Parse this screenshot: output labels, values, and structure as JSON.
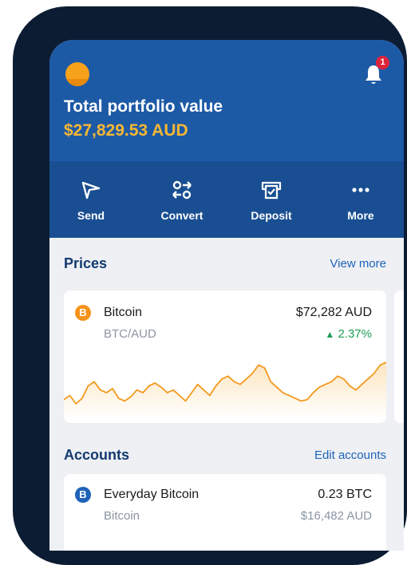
{
  "header": {
    "total_label": "Total portfolio value",
    "total_value": "$27,829.53 AUD",
    "notification_count": "1"
  },
  "actions": [
    {
      "label": "Send",
      "icon": "send-icon"
    },
    {
      "label": "Convert",
      "icon": "convert-icon"
    },
    {
      "label": "Deposit",
      "icon": "deposit-icon"
    },
    {
      "label": "More",
      "icon": "more-icon"
    }
  ],
  "prices": {
    "title": "Prices",
    "link": "View more",
    "card": {
      "name": "Bitcoin",
      "pair": "BTC/AUD",
      "price": "$72,282 AUD",
      "change": "2.37%",
      "change_direction": "up",
      "coin_color": "#f7931a",
      "change_color": "#1f9d55",
      "sparkline": [
        45,
        48,
        42,
        46,
        55,
        58,
        52,
        50,
        53,
        46,
        44,
        47,
        52,
        50,
        55,
        57,
        54,
        50,
        52,
        48,
        44,
        50,
        56,
        52,
        48,
        55,
        60,
        62,
        58,
        56,
        60,
        64,
        70,
        68,
        58,
        54,
        50,
        48,
        46,
        44,
        45,
        50,
        54,
        56,
        58,
        62,
        60,
        55,
        52,
        56,
        60,
        64,
        70,
        72
      ]
    }
  },
  "accounts": {
    "title": "Accounts",
    "link": "Edit accounts",
    "items": [
      {
        "name": "Everyday Bitcoin",
        "amount": "0.23 BTC",
        "sub": "Bitcoin",
        "fiat": "$16,482 AUD",
        "coin_color": "#1f63b8"
      }
    ]
  },
  "colors": {
    "brand": "#1d5aa6",
    "accent": "#f7b733",
    "link": "#1f63b8",
    "title": "#123a6e"
  }
}
